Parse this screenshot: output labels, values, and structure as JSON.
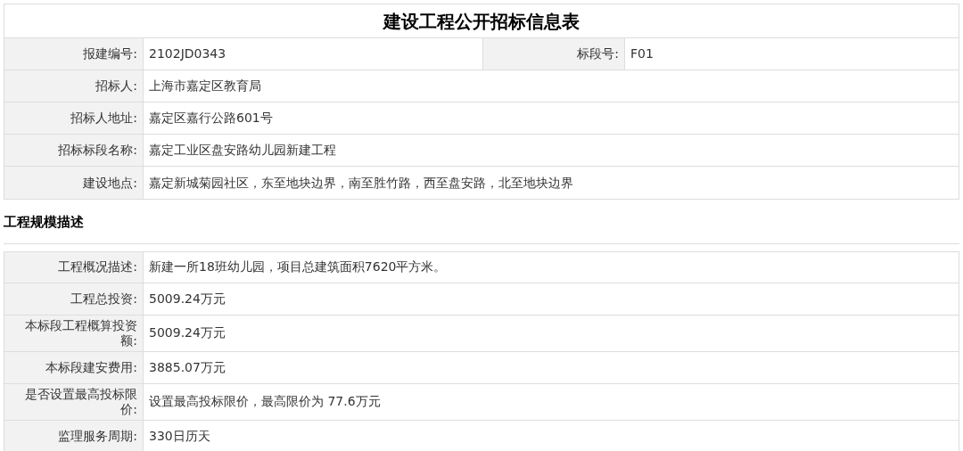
{
  "title": "建设工程公开招标信息表",
  "info_rows": [
    {
      "cells": [
        {
          "label": "报建编号:",
          "value": "2102JD0343"
        },
        {
          "label": "标段号:",
          "value": "F01"
        }
      ]
    },
    {
      "cells": [
        {
          "label": "招标人:",
          "value": "上海市嘉定区教育局"
        }
      ]
    },
    {
      "cells": [
        {
          "label": "招标人地址:",
          "value": "嘉定区嘉行公路601号"
        }
      ]
    },
    {
      "cells": [
        {
          "label": "招标标段名称:",
          "value": "嘉定工业区盘安路幼儿园新建工程"
        }
      ]
    },
    {
      "cells": [
        {
          "label": "建设地点:",
          "value": "嘉定新城菊园社区，东至地块边界，南至胜竹路，西至盘安路，北至地块边界"
        }
      ]
    }
  ],
  "section_heading": "工程规模描述",
  "scale_rows": [
    {
      "label": "工程概况描述:",
      "value": "新建一所18班幼儿园，项目总建筑面积7620平方米。"
    },
    {
      "label": "工程总投资:",
      "value": "5009.24万元"
    },
    {
      "label": "本标段工程概算投资额:",
      "value": "5009.24万元"
    },
    {
      "label": "本标段建安费用:",
      "value": "3885.07万元"
    },
    {
      "label": "是否设置最高投标限价:",
      "value": "设置最高投标限价，最高限价为 77.6万元"
    },
    {
      "label": "监理服务周期:",
      "value": "330日历天"
    }
  ]
}
